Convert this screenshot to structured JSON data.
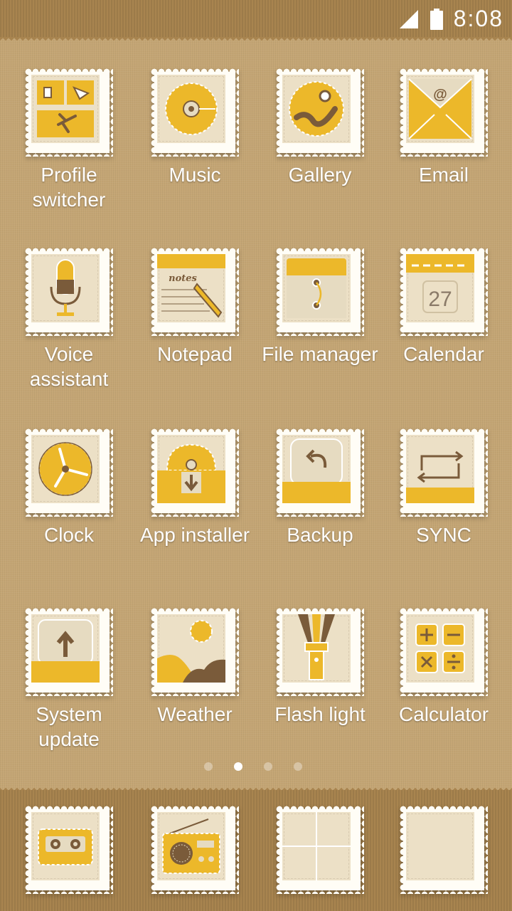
{
  "status_bar": {
    "time": "8:08"
  },
  "apps": [
    {
      "label": "Profile switcher",
      "icon": "profile-switcher-icon"
    },
    {
      "label": "Music",
      "icon": "music-icon"
    },
    {
      "label": "Gallery",
      "icon": "gallery-icon"
    },
    {
      "label": "Email",
      "icon": "email-icon"
    },
    {
      "label": "Voice assistant",
      "icon": "microphone-icon"
    },
    {
      "label": "Notepad",
      "icon": "notepad-icon",
      "icon_text": "notes"
    },
    {
      "label": "File manager",
      "icon": "folder-icon"
    },
    {
      "label": "Calendar",
      "icon": "calendar-icon",
      "icon_text": "27"
    },
    {
      "label": "Clock",
      "icon": "clock-icon"
    },
    {
      "label": "App installer",
      "icon": "app-installer-icon"
    },
    {
      "label": "Backup",
      "icon": "backup-icon"
    },
    {
      "label": "SYNC",
      "icon": "sync-icon"
    },
    {
      "label": "System update",
      "icon": "system-update-icon"
    },
    {
      "label": "Weather",
      "icon": "weather-icon"
    },
    {
      "label": "Flash light",
      "icon": "flashlight-icon"
    },
    {
      "label": "Calculator",
      "icon": "calculator-icon"
    }
  ],
  "page_indicator": {
    "count": 4,
    "active_index": 1
  },
  "dock": [
    {
      "icon": "cassette-icon"
    },
    {
      "icon": "radio-icon"
    },
    {
      "icon": "grid-folder-icon"
    },
    {
      "icon": "blank-stamp-icon"
    }
  ],
  "colors": {
    "yellow": "#ecb82a",
    "brown": "#7a5b3a",
    "paper": "#ece0c6",
    "background": "#c4a574"
  }
}
